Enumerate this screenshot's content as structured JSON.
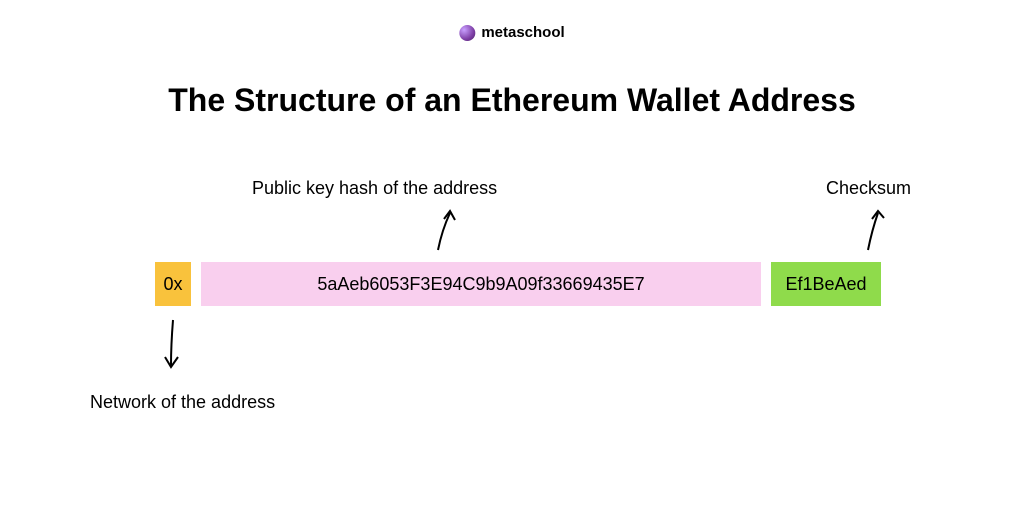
{
  "brand": {
    "name": "metaschool"
  },
  "title": "The Structure of an Ethereum Wallet Address",
  "labels": {
    "hash": "Public key hash of the address",
    "checksum": "Checksum",
    "network": "Network of the address"
  },
  "segments": {
    "prefix": "0x",
    "hash": "5aAeb6053F3E94C9b9A09f33669435E7",
    "checksum": "Ef1BeAed"
  }
}
